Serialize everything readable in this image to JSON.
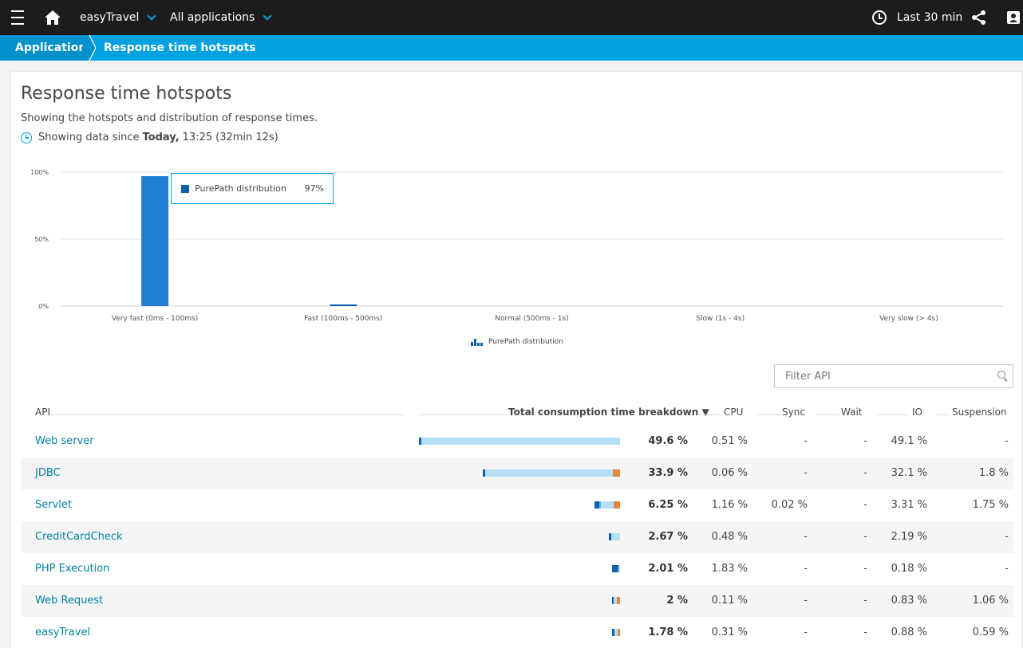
{
  "topbar": {
    "environment": "easyTravel",
    "app_filter": "All applications",
    "timeframe": "Last 30 min"
  },
  "breadcrumb": {
    "parent": "Applications",
    "current": "Response time hotspots"
  },
  "page": {
    "title": "Response time hotspots",
    "subtitle": "Showing the hotspots and distribution of response times.",
    "since_prefix": "Showing data since",
    "since_bold": "Today,",
    "since_time": "13:25",
    "since_duration": "(32min 12s)"
  },
  "chart_data": {
    "type": "bar",
    "categories": [
      "Very fast (0ms - 100ms)",
      "Fast (100ms - 500ms)",
      "Normal (500ms - 1s)",
      "Slow (1s - 4s)",
      "Very slow (> 4s)"
    ],
    "series": [
      {
        "name": "PurePath distribution",
        "values": [
          97,
          1,
          0,
          0,
          0
        ]
      }
    ],
    "ylim": [
      0,
      100
    ],
    "yticks": [
      "100%",
      "50%",
      "0%"
    ],
    "ytick_values": [
      100,
      50,
      0
    ],
    "grid": true,
    "color": "#1e7fd4",
    "tooltip": {
      "label": "PurePath distribution",
      "value": "97%"
    },
    "legend": "bottom-center"
  },
  "filter": {
    "placeholder": "Filter API"
  },
  "table": {
    "headers": {
      "api": "API",
      "total": "Total consumption time breakdown ▼",
      "cpu": "CPU",
      "sync": "Sync",
      "wait": "Wait",
      "io": "IO",
      "suspension": "Suspension"
    },
    "colors": {
      "cpu": "#1060b0",
      "sync": "#66b7e8",
      "io": "#b3e0f6",
      "suspension": "#e8873a"
    },
    "rows": [
      {
        "api": "Web server",
        "total": "49.6 %",
        "cpu": "0.51 %",
        "sync": "-",
        "wait": "-",
        "io": "49.1 %",
        "suspension": "-",
        "parts": [
          0.51,
          0,
          49.1,
          0
        ]
      },
      {
        "api": "JDBC",
        "total": "33.9 %",
        "cpu": "0.06 %",
        "sync": "-",
        "wait": "-",
        "io": "32.1 %",
        "suspension": "1.8 %",
        "parts": [
          0.06,
          0,
          32.1,
          1.8
        ]
      },
      {
        "api": "Servlet",
        "total": "6.25 %",
        "cpu": "1.16 %",
        "sync": "0.02 %",
        "wait": "-",
        "io": "3.31 %",
        "suspension": "1.75 %",
        "parts": [
          1.16,
          0.02,
          3.31,
          1.75
        ]
      },
      {
        "api": "CreditCardCheck",
        "total": "2.67 %",
        "cpu": "0.48 %",
        "sync": "-",
        "wait": "-",
        "io": "2.19 %",
        "suspension": "-",
        "parts": [
          0.48,
          0,
          2.19,
          0
        ]
      },
      {
        "api": "PHP Execution",
        "total": "2.01 %",
        "cpu": "1.83 %",
        "sync": "-",
        "wait": "-",
        "io": "0.18 %",
        "suspension": "-",
        "parts": [
          1.83,
          0,
          0.18,
          0
        ]
      },
      {
        "api": "Web Request",
        "total": "2 %",
        "cpu": "0.11 %",
        "sync": "-",
        "wait": "-",
        "io": "0.83 %",
        "suspension": "1.06 %",
        "parts": [
          0.11,
          0,
          0.83,
          1.06
        ]
      },
      {
        "api": "easyTravel",
        "total": "1.78 %",
        "cpu": "0.31 %",
        "sync": "-",
        "wait": "-",
        "io": "0.88 %",
        "suspension": "0.59 %",
        "parts": [
          0.31,
          0,
          0.88,
          0.59
        ]
      }
    ]
  }
}
